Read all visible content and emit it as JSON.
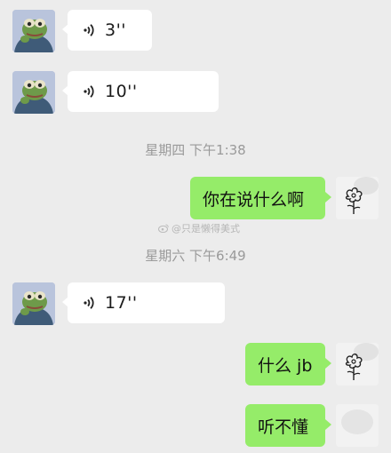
{
  "messages": [
    {
      "side": "left",
      "kind": "voice",
      "length": "3''"
    },
    {
      "side": "left",
      "kind": "voice",
      "length": "10''"
    },
    {
      "kind": "timestamp",
      "text": "星期四 下午1:38"
    },
    {
      "side": "right",
      "kind": "text",
      "text": "你在说什么啊"
    },
    {
      "kind": "timestamp",
      "text": "星期六 下午6:49"
    },
    {
      "side": "left",
      "kind": "voice",
      "length": "17''"
    },
    {
      "side": "right",
      "kind": "text",
      "text": "什么 jb"
    },
    {
      "side": "right",
      "kind": "text",
      "text": "听不懂"
    }
  ],
  "watermark": "@只是懒得美式",
  "colors": {
    "background": "#ececec",
    "received_bubble": "#ffffff",
    "sent_bubble": "#95ec69",
    "timestamp_text": "#9a9a9a"
  },
  "icons": {
    "received_avatar": "pepe-frog-avatar",
    "sent_avatar": "flower-doodle-avatar",
    "voice": "voice-wave-icon"
  }
}
